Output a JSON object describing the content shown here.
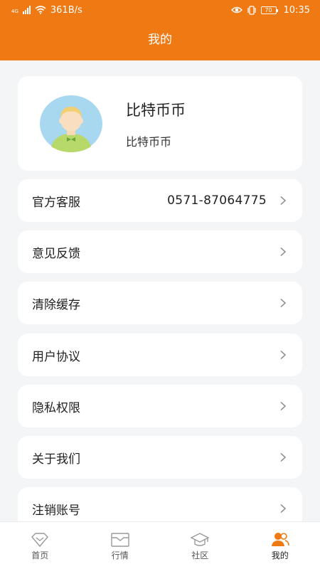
{
  "status_bar": {
    "network": "4G",
    "speed": "361B/s",
    "battery": "70",
    "time": "10:35"
  },
  "header": {
    "title": "我的"
  },
  "profile": {
    "name": "比特币币",
    "subtitle": "比特币币"
  },
  "menu": [
    {
      "label": "官方客服",
      "value": "0571-87064775"
    },
    {
      "label": "意见反馈"
    },
    {
      "label": "清除缓存"
    },
    {
      "label": "用户协议"
    },
    {
      "label": "隐私权限"
    },
    {
      "label": "关于我们"
    },
    {
      "label": "注销账号"
    }
  ],
  "tabbar": {
    "items": [
      {
        "label": "首页",
        "icon": "home-diamond-icon"
      },
      {
        "label": "行情",
        "icon": "market-tray-icon"
      },
      {
        "label": "社区",
        "icon": "community-cap-icon"
      },
      {
        "label": "我的",
        "icon": "profile-people-icon",
        "active": true
      }
    ]
  },
  "colors": {
    "accent": "#ef7a14",
    "background": "#f4f5f7"
  }
}
